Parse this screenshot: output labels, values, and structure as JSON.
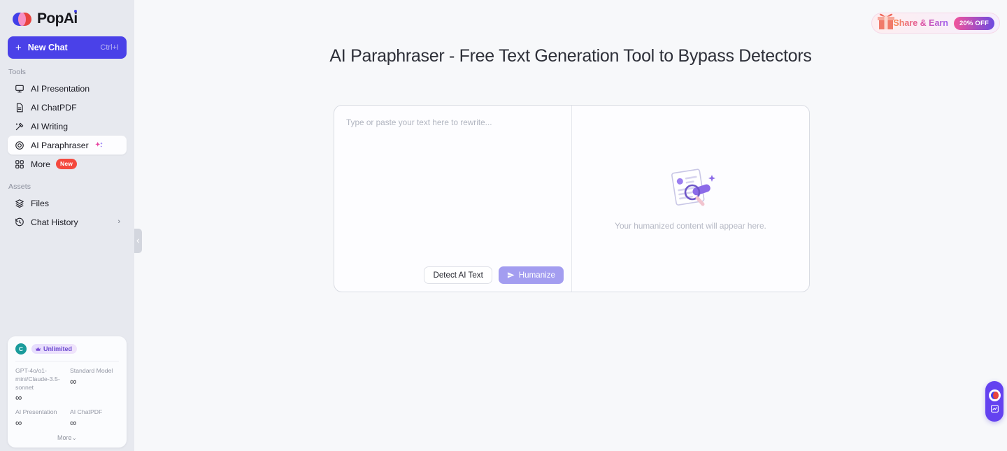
{
  "brand": {
    "name": "PopAi"
  },
  "sidebar": {
    "new_chat": {
      "label": "New Chat",
      "shortcut": "Ctrl+I",
      "plus": "+"
    },
    "sections": [
      {
        "label": "Tools",
        "items": [
          {
            "label": "AI Presentation",
            "icon": "presentation-icon",
            "active": false
          },
          {
            "label": "AI ChatPDF",
            "icon": "document-icon",
            "active": false
          },
          {
            "label": "AI Writing",
            "icon": "magic-pen-icon",
            "active": false
          },
          {
            "label": "AI Paraphraser",
            "icon": "target-icon",
            "active": true,
            "sparkle": true
          },
          {
            "label": "More",
            "icon": "grid-icon",
            "active": false,
            "badge": "New"
          }
        ]
      },
      {
        "label": "Assets",
        "items": [
          {
            "label": "Files",
            "icon": "layers-icon",
            "active": false
          },
          {
            "label": "Chat History",
            "icon": "clock-icon",
            "active": false,
            "chevron": true
          }
        ]
      }
    ],
    "quota": {
      "avatar_initial": "C",
      "plan_badge": "Unlimited",
      "items": [
        {
          "name": "GPT-4o/o1-mini/Claude-3.5-sonnet",
          "value": "∞"
        },
        {
          "name": "Standard Model",
          "value": "∞"
        },
        {
          "name": "AI Presentation",
          "value": "∞"
        },
        {
          "name": "AI ChatPDF",
          "value": "∞"
        }
      ],
      "more_label": "More"
    }
  },
  "header": {
    "share_earn": {
      "label": "Share & Earn",
      "discount": "20% OFF"
    }
  },
  "main": {
    "title": "AI Paraphraser - Free Text Generation Tool to Bypass Detectors",
    "editor": {
      "input_placeholder": "Type or paste your text here to rewrite...",
      "input_value": "",
      "detect_button": "Detect AI Text",
      "humanize_button": "Humanize",
      "output_empty_text": "Your humanized content will appear here."
    }
  },
  "colors": {
    "sidebar_bg": "#e7e9ef",
    "main_bg": "#f7f8fa",
    "accent_blue": "#4a41e8",
    "humanize_purple": "#a39df0",
    "badge_red": "#f4493e",
    "fab_purple": "#6442f0"
  }
}
